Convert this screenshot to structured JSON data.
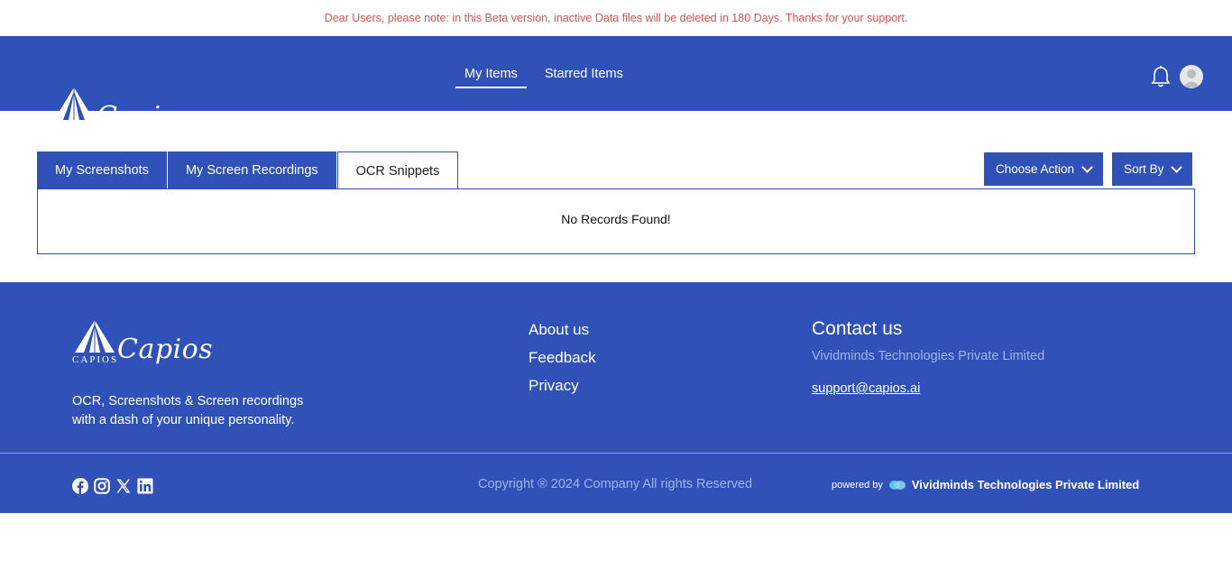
{
  "banner": {
    "text": "Dear Users, please note: in this Beta version, inactive Data files will be deleted in 180 Days. Thanks for your support."
  },
  "brand": {
    "script": "Capios",
    "small": "CAPIOS"
  },
  "nav": {
    "items": [
      {
        "label": "My Items",
        "active": true
      },
      {
        "label": "Starred Items",
        "active": false
      }
    ]
  },
  "header_icons": {
    "notification": "bell-icon",
    "profile": "avatar-icon"
  },
  "tabs": [
    {
      "label": "My Screenshots",
      "active": false
    },
    {
      "label": "My Screen Recordings",
      "active": false
    },
    {
      "label": "OCR Snippets",
      "active": true
    }
  ],
  "controls": {
    "choose_action": "Choose Action",
    "sort_by": "Sort By"
  },
  "content": {
    "empty_message": "No Records Found!"
  },
  "footer": {
    "tagline_line1": "OCR, Screenshots & Screen recordings",
    "tagline_line2": "with a dash of your unique personality.",
    "links": [
      "About us",
      "Feedback",
      "Privacy"
    ],
    "contact_title": "Contact us",
    "company": "Vividminds Technologies Private Limited",
    "email": "support@capios.ai",
    "social_icons": [
      "facebook-icon",
      "instagram-icon",
      "x-icon",
      "linkedin-icon"
    ],
    "copyright": "Copyright ® 2024 Company All rights Reserved",
    "powered_by_label": "powered by",
    "powered_by_company": "Vividminds Technologies Private Limited"
  },
  "colors": {
    "primary": "#3052b8",
    "banner_text": "#d9534f",
    "muted_text": "#9fb3e8"
  }
}
